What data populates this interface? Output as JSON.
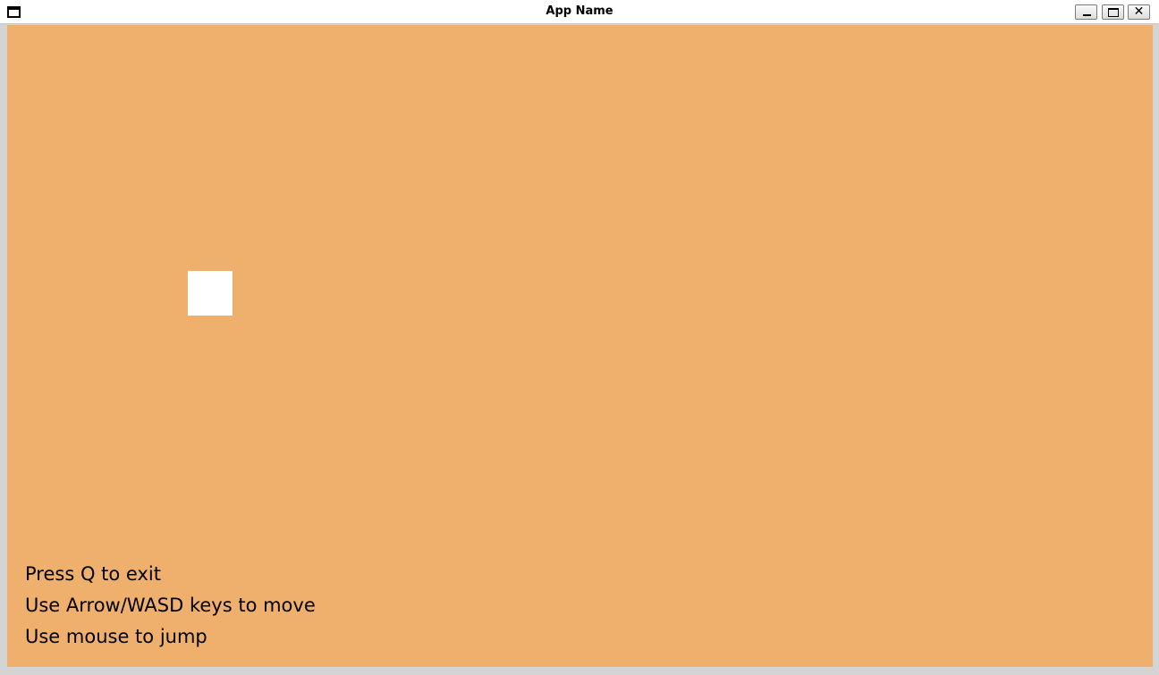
{
  "window": {
    "title": "App Name",
    "icon": "window-icon",
    "controls": {
      "minimize": "minimize-icon",
      "maximize": "maximize-icon",
      "close_label": "✕"
    }
  },
  "game": {
    "background_color": "#efb06e",
    "player_color": "#ffffff",
    "hints": {
      "exit": "Press Q to exit",
      "move": "Use Arrow/WASD keys to move",
      "jump": "Use mouse to jump"
    }
  }
}
